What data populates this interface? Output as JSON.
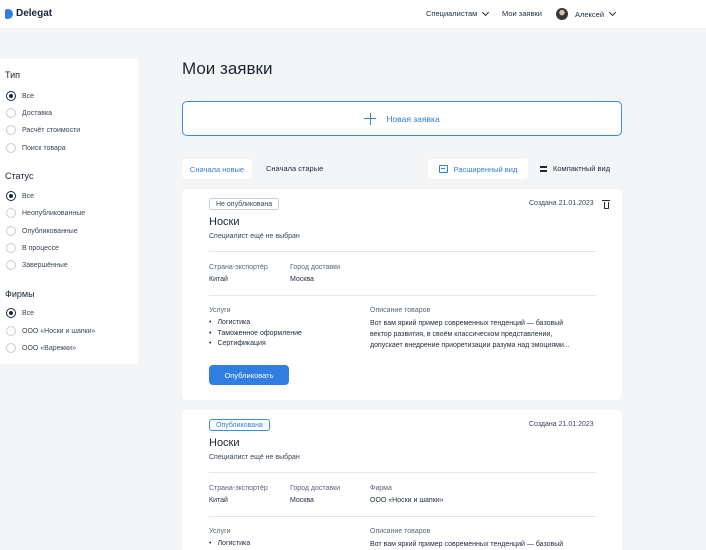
{
  "header": {
    "brand": "Delegat",
    "nav": {
      "specialists": "Специалистам",
      "my_requests": "Мои заявки",
      "user_name": "Алексей"
    }
  },
  "sidebar": {
    "type": {
      "title": "Тип",
      "options": [
        "Все",
        "Доставка",
        "Расчёт стоимости",
        "Поиск товара"
      ],
      "selected": "Все"
    },
    "status": {
      "title": "Статус",
      "options": [
        "Все",
        "Неопубликованные",
        "Опубликованные",
        "В процессе",
        "Завершённые"
      ],
      "selected": "Все"
    },
    "firms": {
      "title": "Фирмы",
      "options": [
        "Все",
        "ООО «Носки и шапки»",
        "ООО «Варежки»"
      ],
      "selected": "Все"
    }
  },
  "main": {
    "title": "Мои заявки",
    "new_request_label": "Новая заявка",
    "sort": {
      "newest": "Сначала новые",
      "oldest": "Сначала старые"
    },
    "view": {
      "extended": "Расширенный вид",
      "compact": "Компактный вид"
    }
  },
  "labels": {
    "export_country": "Страна-экспортёр",
    "delivery_city": "Город доставки",
    "firm": "Фирма",
    "services": "Услуги",
    "goods_description": "Описание товаров",
    "publish": "Опубликовать"
  },
  "cards": [
    {
      "status": "Не опубликована",
      "created": "Создана 21.01.2023",
      "title": "Носки",
      "specialist": "Специалист ещё не выбран",
      "export_country": "Китай",
      "delivery_city": "Москва",
      "services": [
        "Логистика",
        "Таможенное оформление",
        "Сертификация"
      ],
      "description": [
        "Вот вам яркий пример современных тенденций — базовый",
        "вектор развития, в своём классическом представлении,",
        "допускает внедрение приоретизации разума над эмоциями..."
      ]
    },
    {
      "status": "Опубликована",
      "created": "Создана 21.01.2023",
      "title": "Носки",
      "specialist": "Специалист ещё не выбран",
      "export_country": "Китай",
      "delivery_city": "Москва",
      "firm": "ООО «Носки и шапки»",
      "services": [
        "Логистика"
      ],
      "description": [
        "Вот вам яркий пример современных тенденций — базовый"
      ]
    }
  ],
  "colors": {
    "accent": "#2f7ee0",
    "background": "#f4f5f7"
  },
  "icons": [
    "logo-icon",
    "chevron-down-icon",
    "avatar",
    "plus-icon",
    "extended-view-icon",
    "compact-view-icon",
    "trash-icon"
  ]
}
